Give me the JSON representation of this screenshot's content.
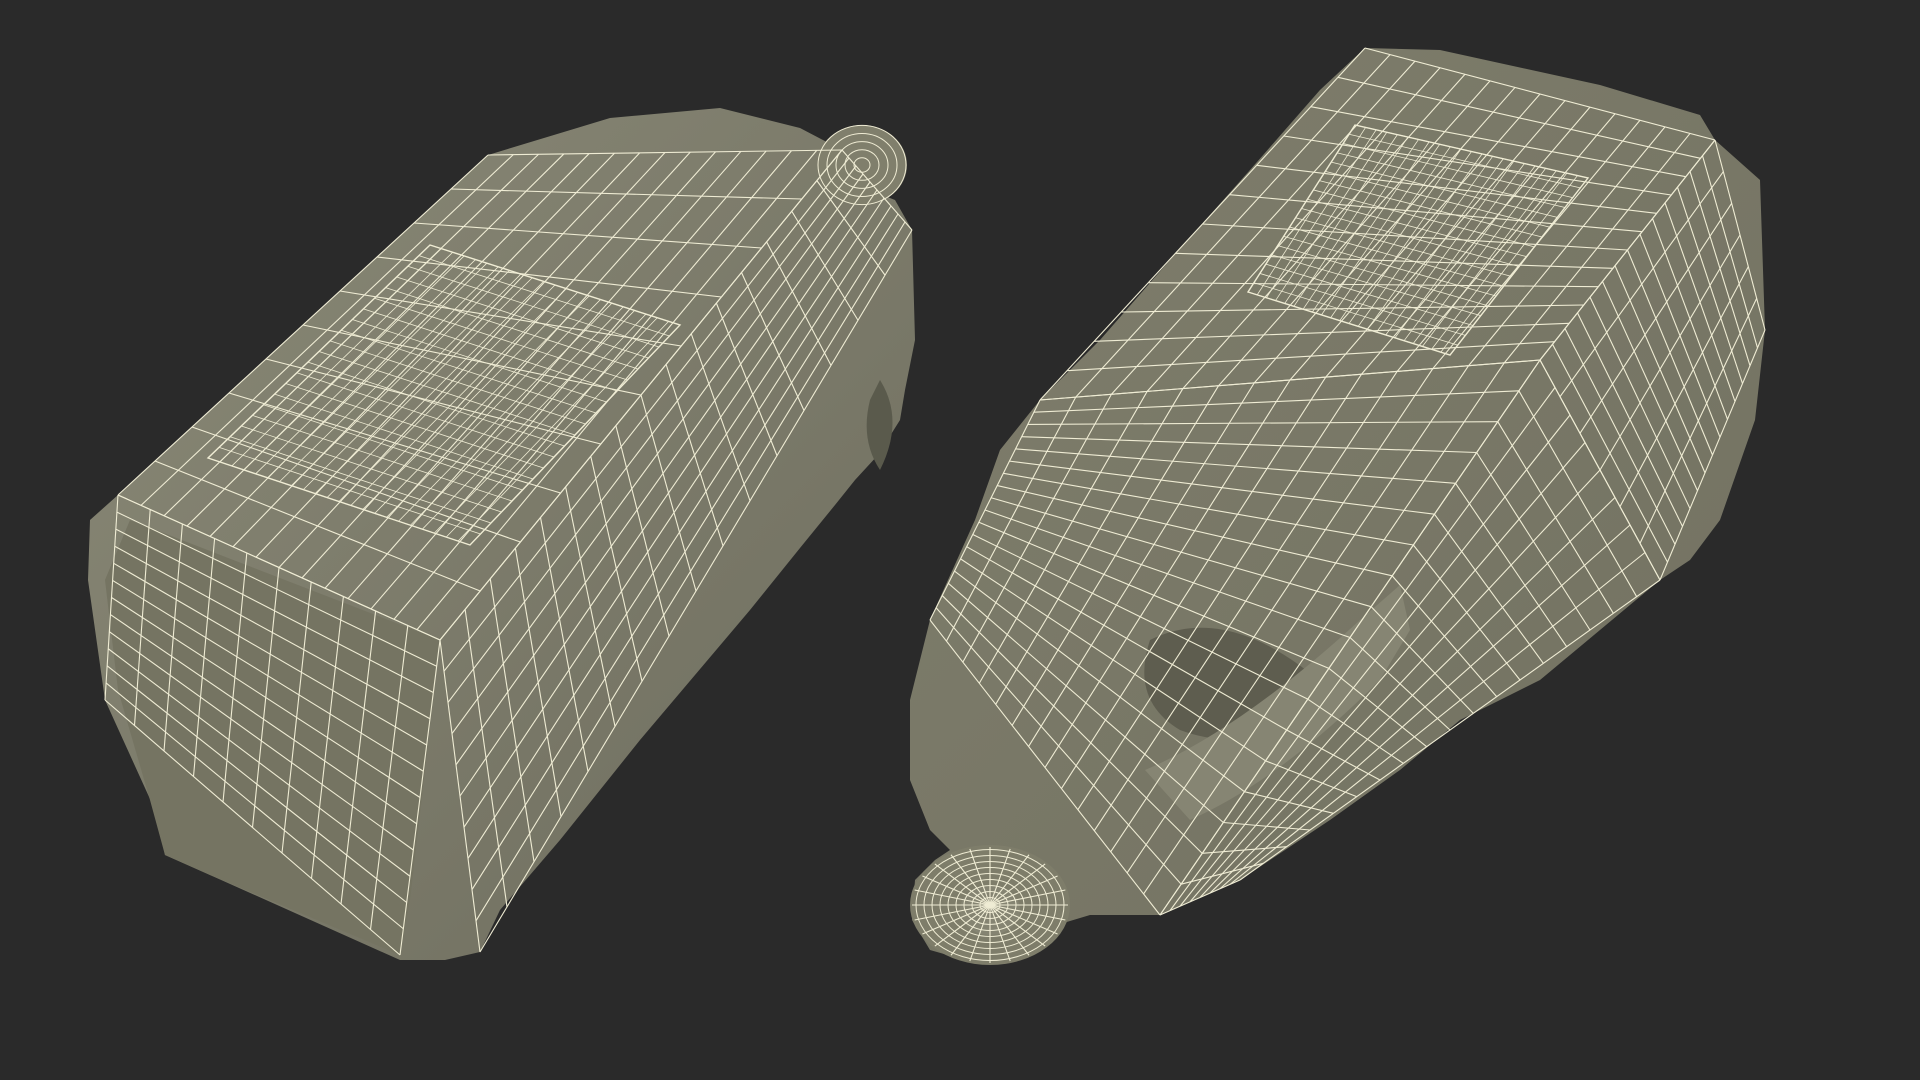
{
  "scene": {
    "background": "#2a2a2a",
    "surface_color": "#7c7b6a",
    "surface_dark": "#5e5e50",
    "surface_light": "#8b8a78",
    "wire_color": "#efecd4",
    "objects": [
      {
        "name": "bottle-lying-left",
        "description_icon": "wireframe-jug-icon"
      },
      {
        "name": "bottle-lying-right",
        "description_icon": "wireframe-jug-icon"
      }
    ]
  }
}
